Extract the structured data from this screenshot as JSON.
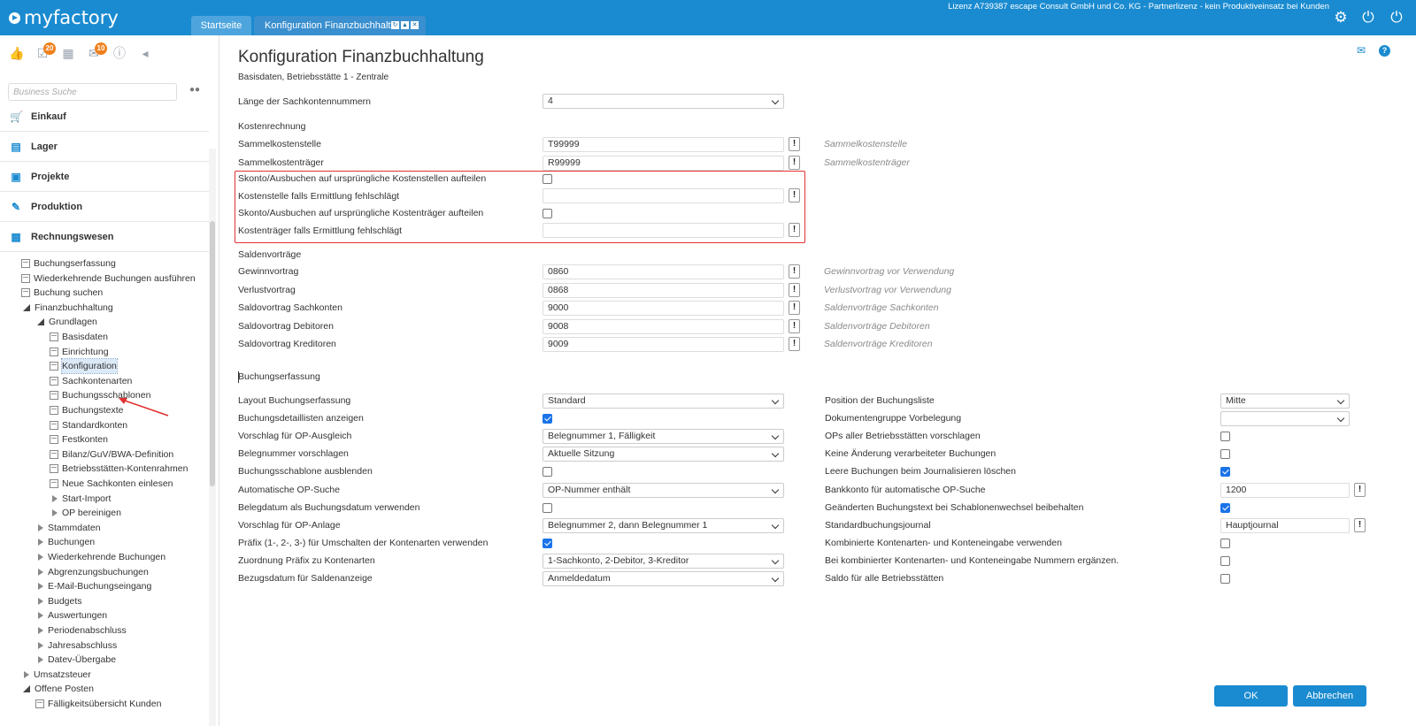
{
  "app": {
    "logo": "myfactory",
    "license": "Lizenz A739387 escape Consult GmbH und Co. KG - Partnerlizenz - kein Produktiveinsatz bei Kunden",
    "tabs": [
      {
        "label": "Startseite"
      },
      {
        "label": "Konfiguration Finanzbuchhalt..."
      }
    ]
  },
  "sidebar": {
    "badges": {
      "tasks": "20",
      "messages": "10"
    },
    "search_placeholder": "Business Suche",
    "modules": [
      {
        "label": "Einkauf",
        "icon": "cart-icon"
      },
      {
        "label": "Lager",
        "icon": "warehouse-icon"
      },
      {
        "label": "Projekte",
        "icon": "projects-icon"
      },
      {
        "label": "Produktion",
        "icon": "production-icon"
      },
      {
        "label": "Rechnungswesen",
        "icon": "accounting-icon"
      }
    ],
    "tree": [
      {
        "label": "Buchungserfassung",
        "level": 1,
        "type": "doc"
      },
      {
        "label": "Wiederkehrende Buchungen ausführen",
        "level": 1,
        "type": "doc"
      },
      {
        "label": "Buchung suchen",
        "level": 1,
        "type": "doc"
      },
      {
        "label": "Finanzbuchhaltung",
        "level": 1,
        "type": "exp"
      },
      {
        "label": "Grundlagen",
        "level": 2,
        "type": "exp"
      },
      {
        "label": "Basisdaten",
        "level": 3,
        "type": "doc"
      },
      {
        "label": "Einrichtung",
        "level": 3,
        "type": "doc"
      },
      {
        "label": "Konfiguration",
        "level": 3,
        "type": "doc",
        "selected": true
      },
      {
        "label": "Sachkontenarten",
        "level": 3,
        "type": "doc"
      },
      {
        "label": "Buchungsschablonen",
        "level": 3,
        "type": "doc"
      },
      {
        "label": "Buchungstexte",
        "level": 3,
        "type": "doc"
      },
      {
        "label": "Standardkonten",
        "level": 3,
        "type": "doc"
      },
      {
        "label": "Festkonten",
        "level": 3,
        "type": "doc"
      },
      {
        "label": "Bilanz/GuV/BWA-Definition",
        "level": 3,
        "type": "doc"
      },
      {
        "label": "Betriebsstätten-Kontenrahmen",
        "level": 3,
        "type": "doc"
      },
      {
        "label": "Neue Sachkonten einlesen",
        "level": 3,
        "type": "doc"
      },
      {
        "label": "Start-Import",
        "level": 3,
        "type": "col"
      },
      {
        "label": "OP bereinigen",
        "level": 3,
        "type": "col"
      },
      {
        "label": "Stammdaten",
        "level": 2,
        "type": "col"
      },
      {
        "label": "Buchungen",
        "level": 2,
        "type": "col"
      },
      {
        "label": "Wiederkehrende Buchungen",
        "level": 2,
        "type": "col"
      },
      {
        "label": "Abgrenzungsbuchungen",
        "level": 2,
        "type": "col"
      },
      {
        "label": "E-Mail-Buchungseingang",
        "level": 2,
        "type": "col"
      },
      {
        "label": "Budgets",
        "level": 2,
        "type": "col"
      },
      {
        "label": "Auswertungen",
        "level": 2,
        "type": "col"
      },
      {
        "label": "Periodenabschluss",
        "level": 2,
        "type": "col"
      },
      {
        "label": "Jahresabschluss",
        "level": 2,
        "type": "col"
      },
      {
        "label": "Datev-Übergabe",
        "level": 2,
        "type": "col"
      },
      {
        "label": "Umsatzsteuer",
        "level": 1,
        "type": "col"
      },
      {
        "label": "Offene Posten",
        "level": 1,
        "type": "exp"
      },
      {
        "label": "Fälligkeitsübersicht Kunden",
        "level": 2,
        "type": "doc"
      }
    ]
  },
  "main": {
    "title": "Konfiguration Finanzbuchhaltung",
    "subtitle": "Basisdaten, Betriebsstätte 1 - Zentrale",
    "account_length": {
      "label": "Länge der Sachkontennummern",
      "value": "4"
    },
    "kostenrechnung": {
      "title": "Kostenrechnung",
      "rows": [
        {
          "label": "Sammelkostenstelle",
          "value": "T99999",
          "hint": "Sammelkostenstelle"
        },
        {
          "label": "Sammelkostenträger",
          "value": "R99999",
          "hint": "Sammelkostenträger"
        }
      ],
      "skonto_kst": {
        "label": "Skonto/Ausbuchen auf ursprüngliche Kostenstellen aufteilen",
        "checked": false
      },
      "kst_fallback": {
        "label": "Kostenstelle falls Ermittlung fehlschlägt",
        "value": ""
      },
      "skonto_ktr": {
        "label": "Skonto/Ausbuchen auf ursprüngliche Kostenträger aufteilen",
        "checked": false
      },
      "ktr_fallback": {
        "label": "Kostenträger falls Ermittlung fehlschlägt",
        "value": ""
      }
    },
    "saldenvortraege": {
      "title": "Saldenvorträge",
      "rows": [
        {
          "label": "Gewinnvortrag",
          "value": "0860",
          "hint": "Gewinnvortrag vor Verwendung"
        },
        {
          "label": "Verlustvortrag",
          "value": "0868",
          "hint": "Verlustvortrag vor Verwendung"
        },
        {
          "label": "Saldovortrag Sachkonten",
          "value": "9000",
          "hint": "Saldenvorträge Sachkonten"
        },
        {
          "label": "Saldovortrag Debitoren",
          "value": "9008",
          "hint": "Saldenvorträge Debitoren"
        },
        {
          "label": "Saldovortrag Kreditoren",
          "value": "9009",
          "hint": "Saldenvorträge Kreditoren"
        }
      ]
    },
    "buchungserfassung": {
      "title": "Buchungserfassung",
      "left": [
        {
          "label": "Layout Buchungserfassung",
          "kind": "select",
          "value": "Standard"
        },
        {
          "label": "Buchungsdetaillisten anzeigen",
          "kind": "check",
          "checked": true
        },
        {
          "label": "Vorschlag für OP-Ausgleich",
          "kind": "select",
          "value": "Belegnummer 1, Fälligkeit"
        },
        {
          "label": "Belegnummer vorschlagen",
          "kind": "select",
          "value": "Aktuelle Sitzung"
        },
        {
          "label": "Buchungsschablone ausblenden",
          "kind": "check",
          "checked": false
        },
        {
          "label": "Automatische OP-Suche",
          "kind": "select",
          "value": "OP-Nummer enthält"
        },
        {
          "label": "Belegdatum als Buchungsdatum verwenden",
          "kind": "check",
          "checked": false
        },
        {
          "label": "Vorschlag für OP-Anlage",
          "kind": "select",
          "value": "Belegnummer 2, dann Belegnummer 1"
        },
        {
          "label": "Präfix (1-, 2-, 3-) für Umschalten der Kontenarten verwenden",
          "kind": "check",
          "checked": true
        },
        {
          "label": "Zuordnung Präfix zu Kontenarten",
          "kind": "select",
          "value": "1-Sachkonto, 2-Debitor, 3-Kreditor"
        },
        {
          "label": "Bezugsdatum für Saldenanzeige",
          "kind": "select",
          "value": "Anmeldedatum"
        }
      ],
      "right": [
        {
          "label": "Position der Buchungsliste",
          "kind": "select",
          "value": "Mitte"
        },
        {
          "label": "Dokumentengruppe Vorbelegung",
          "kind": "select",
          "value": ""
        },
        {
          "label": "OPs aller Betriebsstätten vorschlagen",
          "kind": "check",
          "checked": false
        },
        {
          "label": "Keine Änderung verarbeiteter Buchungen",
          "kind": "check",
          "checked": false
        },
        {
          "label": "Leere Buchungen beim Journalisieren löschen",
          "kind": "check",
          "checked": true
        },
        {
          "label": "Bankkonto für automatische OP-Suche",
          "kind": "input",
          "value": "1200"
        },
        {
          "label": "Geänderten Buchungstext bei Schablonenwechsel beibehalten",
          "kind": "check",
          "checked": true
        },
        {
          "label": "Standardbuchungsjournal",
          "kind": "input",
          "value": "Hauptjournal"
        },
        {
          "label": "Kombinierte Kontenarten- und Konteneingabe verwenden",
          "kind": "check",
          "checked": false
        },
        {
          "label": "Bei kombinierter Kontenarten- und Konteneingabe Nummern ergänzen.",
          "kind": "check",
          "checked": false
        },
        {
          "label": "Saldo für alle Betriebsstätten",
          "kind": "check",
          "checked": false
        }
      ]
    },
    "buttons": {
      "ok": "OK",
      "cancel": "Abbrechen"
    },
    "excl_symbol": "!"
  },
  "colors": {
    "brand": "#1a8bd0",
    "highlight": "#e03131",
    "checked": "#1a73e8"
  }
}
